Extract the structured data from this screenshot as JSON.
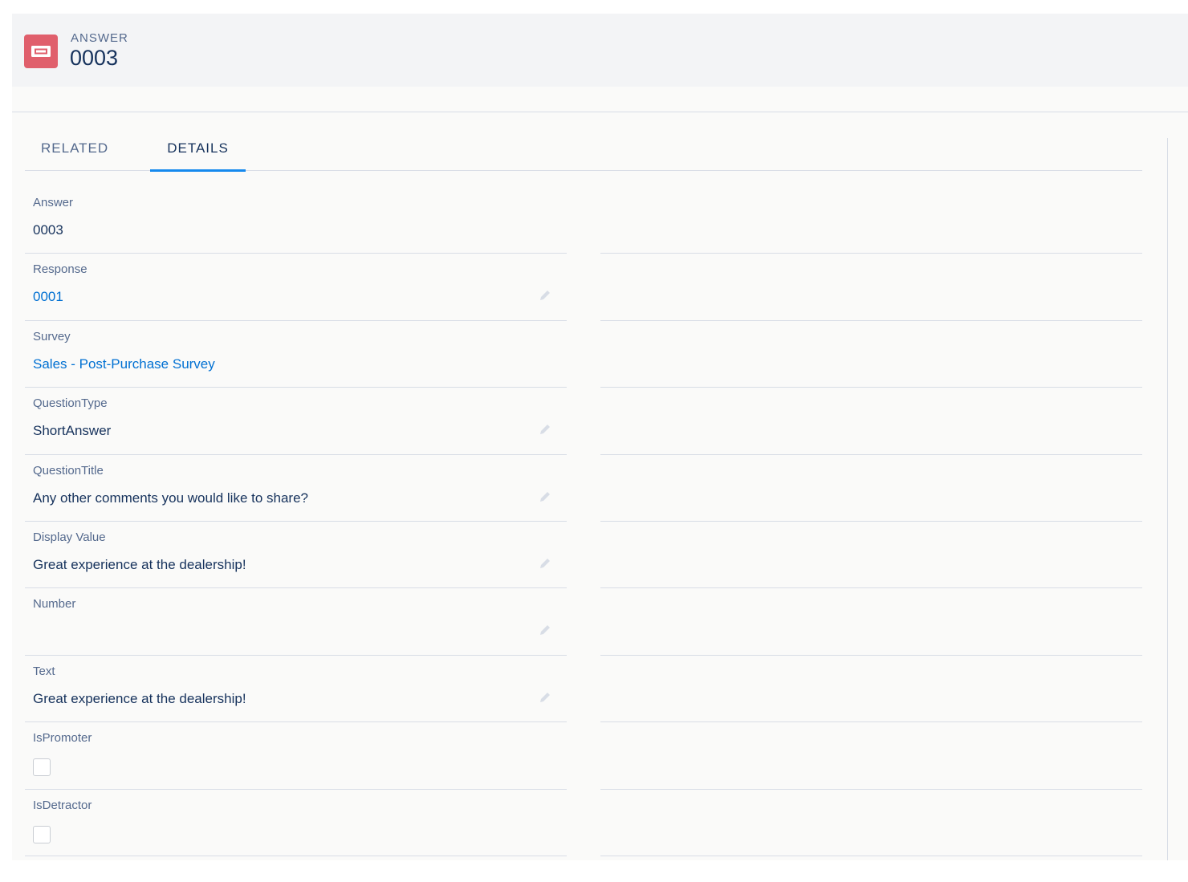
{
  "header": {
    "object_label": "ANSWER",
    "record_title": "0003",
    "icon": "ticket-icon",
    "icon_color": "#e05f6c"
  },
  "tabs": [
    {
      "label": "RELATED",
      "active": false
    },
    {
      "label": "DETAILS",
      "active": true
    }
  ],
  "fields": [
    {
      "label": "Answer",
      "value": "0003",
      "type": "text",
      "editable": false
    },
    {
      "label": "Response",
      "value": "0001",
      "type": "link",
      "editable": true
    },
    {
      "label": "Survey",
      "value": "Sales - Post-Purchase Survey",
      "type": "link",
      "editable": false
    },
    {
      "label": "QuestionType",
      "value": "ShortAnswer",
      "type": "text",
      "editable": true
    },
    {
      "label": "QuestionTitle",
      "value": "Any other comments you would like to share?",
      "type": "text",
      "editable": true
    },
    {
      "label": "Display Value",
      "value": "Great experience at the dealership!",
      "type": "text",
      "editable": true
    },
    {
      "label": "Number",
      "value": "",
      "type": "text",
      "editable": true
    },
    {
      "label": "Text",
      "value": "Great experience at the dealership!",
      "type": "text",
      "editable": true
    },
    {
      "label": "IsPromoter",
      "checked": false,
      "type": "checkbox",
      "editable": false
    },
    {
      "label": "IsDetractor",
      "checked": false,
      "type": "checkbox",
      "editable": false
    }
  ],
  "colors": {
    "link": "#0070d2",
    "active_tab_underline": "#1589ee",
    "label": "#54698d",
    "text": "#16325c"
  }
}
